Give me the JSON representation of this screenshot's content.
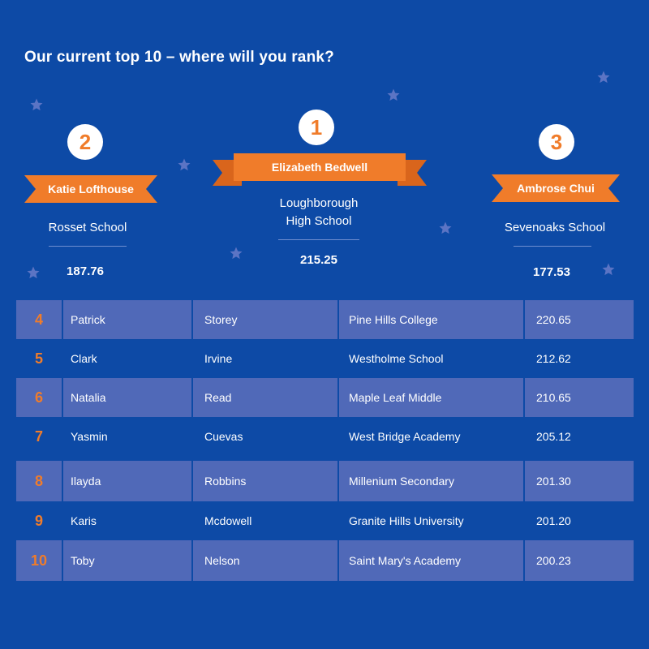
{
  "heading": "Our current top 10 – where will you rank?",
  "podium": {
    "first": {
      "rank": "1",
      "name": "Elizabeth Bedwell",
      "school_line1": "Loughborough",
      "school_line2": "High School",
      "score": "215.25"
    },
    "second": {
      "rank": "2",
      "name": "Katie Lofthouse",
      "school": "Rosset School",
      "score": "187.76"
    },
    "third": {
      "rank": "3",
      "name": "Ambrose Chui",
      "school": "Sevenoaks School",
      "score": "177.53"
    }
  },
  "rows": [
    {
      "rank": "4",
      "first": "Patrick",
      "last": "Storey",
      "school": "Pine Hills College",
      "score": "220.65"
    },
    {
      "rank": "5",
      "first": "Clark",
      "last": "Irvine",
      "school": "Westholme School",
      "score": "212.62"
    },
    {
      "rank": "6",
      "first": "Natalia",
      "last": "Read",
      "school": "Maple Leaf Middle",
      "score": "210.65"
    },
    {
      "rank": "7",
      "first": "Yasmin",
      "last": "Cuevas",
      "school": "West Bridge Academy",
      "score": "205.12"
    },
    {
      "rank": "8",
      "first": "Ilayda",
      "last": "Robbins",
      "school": "Millenium Secondary",
      "score": "201.30"
    },
    {
      "rank": "9",
      "first": "Karis",
      "last": "Mcdowell",
      "school": "Granite Hills University",
      "score": "201.20"
    },
    {
      "rank": "10",
      "first": "Toby",
      "last": "Nelson",
      "school": "Saint Mary's Academy",
      "score": "200.23"
    }
  ],
  "colors": {
    "background": "#0d4aa6",
    "accent": "#f07c2a",
    "row_shade": "#5069b8",
    "star": "#5b74c4"
  }
}
